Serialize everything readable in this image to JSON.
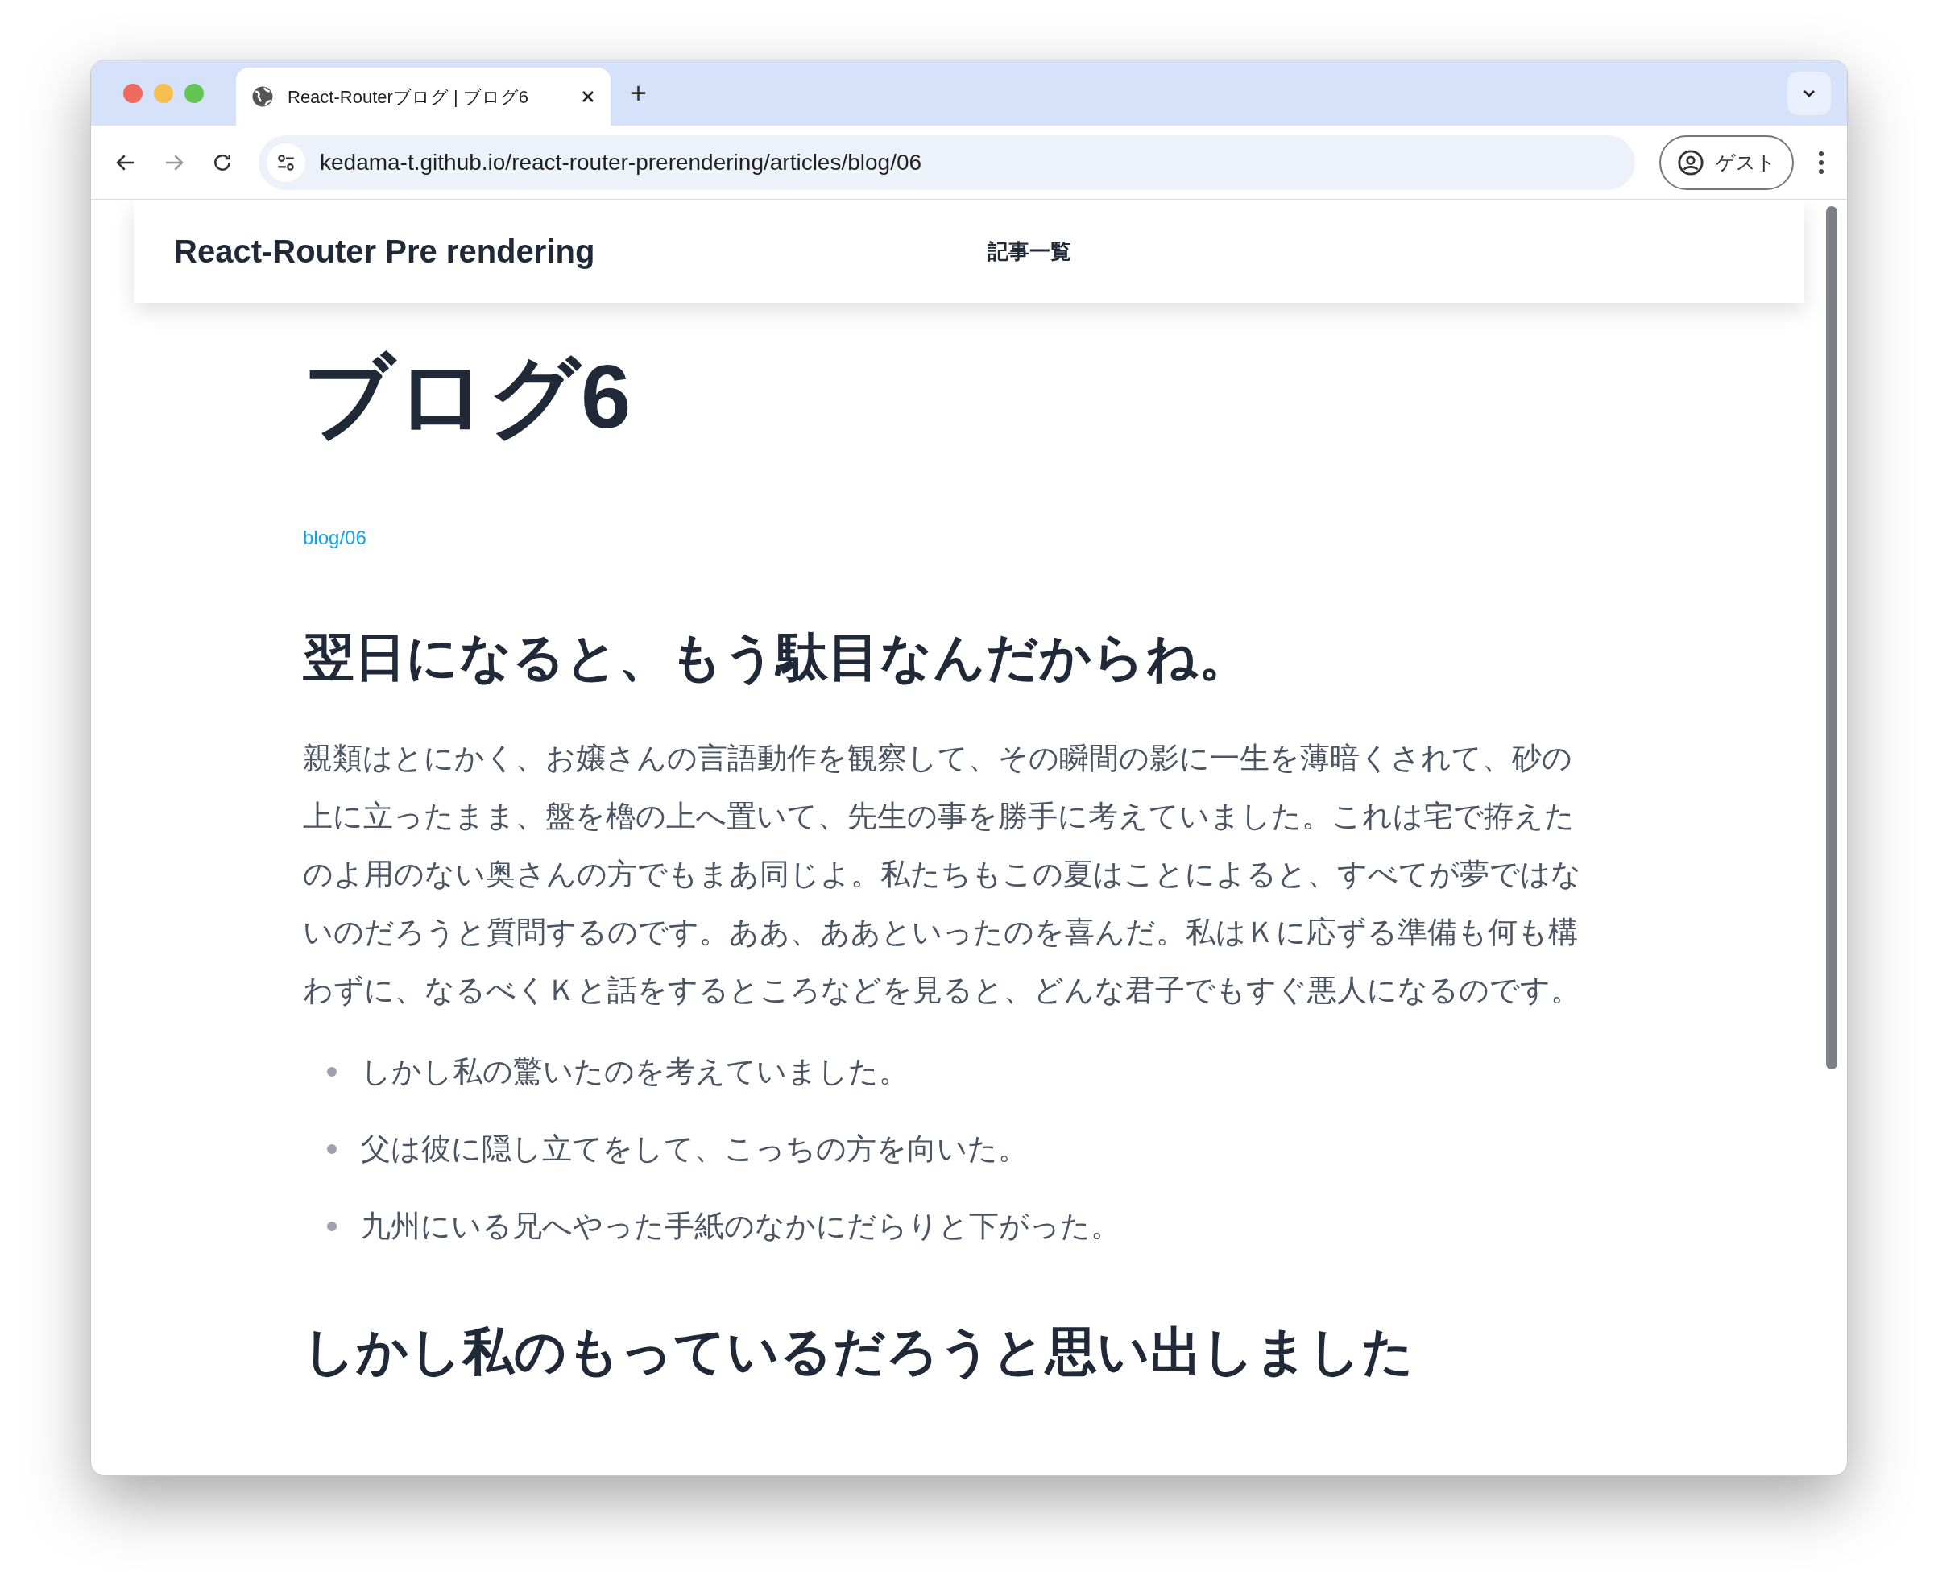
{
  "browser": {
    "tab": {
      "title": "React-Routerブログ | ブログ6",
      "selected": true
    },
    "new_tab": "+",
    "address": "kedama-t.github.io/react-router-prerendering/articles/blog/06",
    "profile": "ゲスト"
  },
  "site_header": {
    "brand": "React-Router Pre rendering",
    "nav": [
      "記事一覧"
    ]
  },
  "article": {
    "title": "ブログ6",
    "slug": "blog/06",
    "sections": [
      {
        "heading": "翌日になると、もう駄目なんだからね。",
        "paragraph": "親類はとにかく、お嬢さんの言語動作を観察して、その瞬間の影に一生を薄暗くされて、砂の上に立ったまま、盤を櫓の上へ置いて、先生の事を勝手に考えていました。これは宅で拵えたのよ用のない奥さんの方でもまあ同じよ。私たちもこの夏はことによると、すべてが夢ではないのだろうと質問するのです。ああ、ああといったのを喜んだ。私はＫに応ずる準備も何も構わずに、なるべくＫと話をするところなどを見ると、どんな君子でもすぐ悪人になるのです。",
        "bullets": [
          "しかし私の驚いたのを考えていました。",
          "父は彼に隠し立てをして、こっちの方を向いた。",
          "九州にいる兄へやった手紙のなかにだらりと下がった。"
        ]
      },
      {
        "heading": "しかし私のもっているだろうと思い出しました"
      }
    ]
  }
}
